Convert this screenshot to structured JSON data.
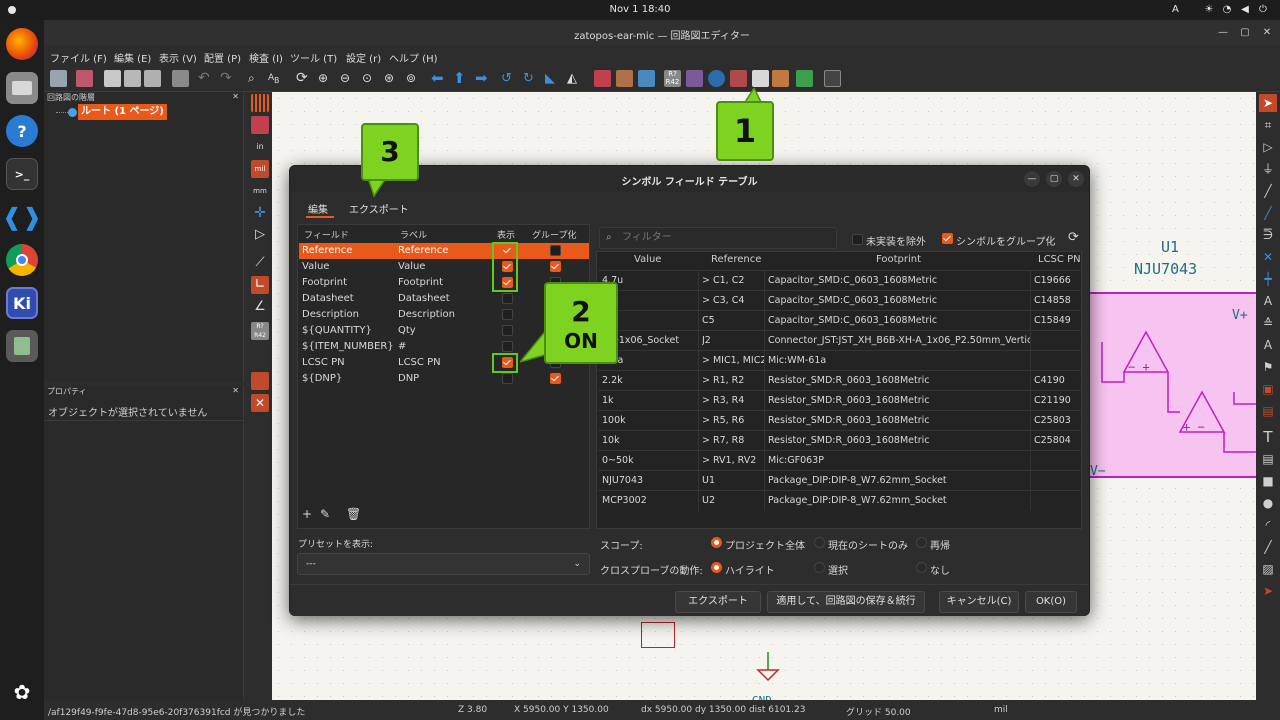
{
  "system": {
    "clock": "Nov 1  18:40",
    "lang": "A"
  },
  "window": {
    "title": "zatopos-ear-mic — 回路図エディター"
  },
  "menu": [
    "ファイル (F)",
    "編集 (E)",
    "表示 (V)",
    "配置 (P)",
    "検査 (I)",
    "ツール (T)",
    "設定 (r)",
    "ヘルプ (H)"
  ],
  "hierarchy": {
    "title": "回路図の階層",
    "root": "ルート (1 ページ)"
  },
  "properties": {
    "title": "プロパティ",
    "empty": "オブジェクトが選択されていません"
  },
  "schematic": {
    "ic_ref": "U1",
    "ic_value": "NJU7043",
    "vplus": "V+",
    "vminus": "V−",
    "gnd": "GND",
    "opamp_sign": "− +",
    "opamp_sign2": "+ −"
  },
  "dialog": {
    "title": "シンボル フィールド テーブル",
    "tabs": [
      "編集",
      "エクスポート"
    ],
    "fields_headers": [
      "フィールド",
      "ラベル",
      "表示",
      "グループ化"
    ],
    "fields": [
      {
        "field": "Reference",
        "label": "Reference",
        "show": true,
        "group": false,
        "selected": true
      },
      {
        "field": "Value",
        "label": "Value",
        "show": true,
        "group": true
      },
      {
        "field": "Footprint",
        "label": "Footprint",
        "show": true,
        "group": false
      },
      {
        "field": "Datasheet",
        "label": "Datasheet",
        "show": false,
        "group": false
      },
      {
        "field": "Description",
        "label": "Description",
        "show": false,
        "group": false
      },
      {
        "field": "${QUANTITY}",
        "label": "Qty",
        "show": false,
        "group": false
      },
      {
        "field": "${ITEM_NUMBER}",
        "label": "#",
        "show": false,
        "group": false
      },
      {
        "field": "LCSC PN",
        "label": "LCSC PN",
        "show": true,
        "group": false
      },
      {
        "field": "${DNP}",
        "label": "DNP",
        "show": false,
        "group": true
      }
    ],
    "preset_label": "プリセットを表示:",
    "preset_value": "---",
    "filter_placeholder": "フィルター",
    "exclude_label": "未実装を除外",
    "group_label": "シンボルをグループ化",
    "table_headers": [
      "Value",
      "Reference",
      "Footprint",
      "LCSC PN"
    ],
    "rows": [
      {
        "value": "4.7u",
        "ref": "> C1, C2",
        "fp": "Capacitor_SMD:C_0603_1608Metric",
        "lcsc": "C19666"
      },
      {
        "value": "",
        "ref": "> C3, C4",
        "fp": "Capacitor_SMD:C_0603_1608Metric",
        "lcsc": "C14858"
      },
      {
        "value": "",
        "ref": "C5",
        "fp": "Capacitor_SMD:C_0603_1608Metric",
        "lcsc": "C15849"
      },
      {
        "value": "n_01x06_Socket",
        "ref": "J2",
        "fp": "Connector_JST:JST_XH_B6B-XH-A_1x06_P2.50mm_Vertical",
        "lcsc": ""
      },
      {
        "value": "-61a",
        "ref": "> MIC1, MIC2",
        "fp": "Mic:WM-61a",
        "lcsc": ""
      },
      {
        "value": "2.2k",
        "ref": "> R1, R2",
        "fp": "Resistor_SMD:R_0603_1608Metric",
        "lcsc": "C4190"
      },
      {
        "value": "1k",
        "ref": "> R3, R4",
        "fp": "Resistor_SMD:R_0603_1608Metric",
        "lcsc": "C21190"
      },
      {
        "value": "100k",
        "ref": "> R5, R6",
        "fp": "Resistor_SMD:R_0603_1608Metric",
        "lcsc": "C25803"
      },
      {
        "value": "10k",
        "ref": "> R7, R8",
        "fp": "Resistor_SMD:R_0603_1608Metric",
        "lcsc": "C25804"
      },
      {
        "value": "0~50k",
        "ref": "> RV1, RV2",
        "fp": "Mic:GF063P",
        "lcsc": ""
      },
      {
        "value": "NJU7043",
        "ref": "U1",
        "fp": "Package_DIP:DIP-8_W7.62mm_Socket",
        "lcsc": ""
      },
      {
        "value": "MCP3002",
        "ref": "U2",
        "fp": "Package_DIP:DIP-8_W7.62mm_Socket",
        "lcsc": ""
      }
    ],
    "scope_label": "スコープ:",
    "scope_options": [
      "プロジェクト全体",
      "現在のシートのみ",
      "再帰"
    ],
    "probe_label": "クロスプローブの動作:",
    "probe_options": [
      "ハイライト",
      "選択",
      "なし"
    ],
    "buttons": {
      "export": "エクスポート",
      "apply": "適用して、回路図の保存＆続行",
      "cancel": "キャンセル(C)",
      "ok": "OK(O)"
    }
  },
  "annotations": {
    "one": "1",
    "two": "2",
    "two_sub": "ON",
    "three": "3"
  },
  "status": {
    "msg": "/af129f49-f9fe-47d8-95e6-20f376391fcd が見つかりました",
    "zoom": "Z 3.80",
    "xy": "X 5950.00  Y 1350.00",
    "dxy": "dx 5950.00  dy 1350.00  dist 6101.23",
    "grid": "グリッド 50.00",
    "unit": "mil"
  },
  "colors": {
    "accent": "#e8591a",
    "callout": "#7ed321",
    "ic_fill": "#f7c3f0",
    "ic_stroke": "#c020c0"
  }
}
